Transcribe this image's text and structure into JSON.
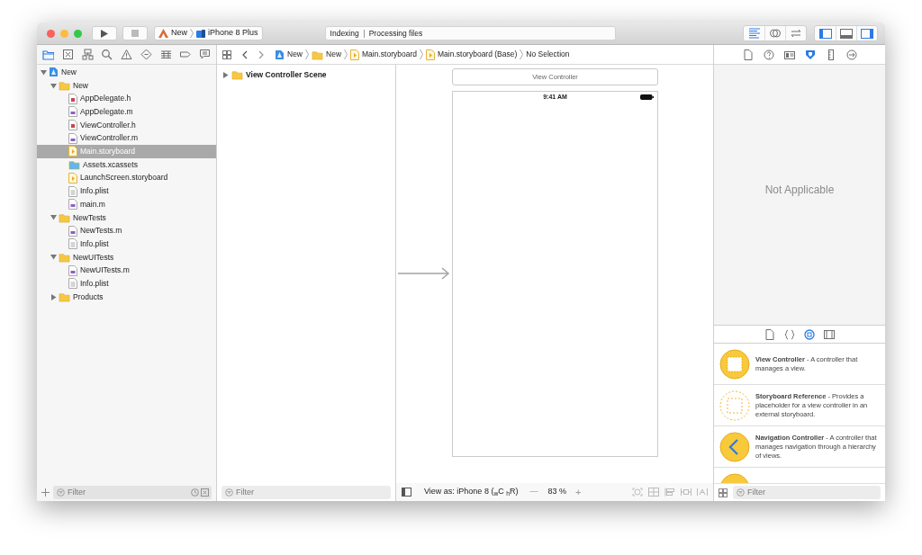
{
  "toolbar": {
    "run_button": {
      "disabled": false
    },
    "stop_button": {
      "disabled": true
    },
    "scheme": {
      "project": "New",
      "device": "iPhone 8 Plus"
    },
    "activity": {
      "status": "Indexing",
      "detail": "Processing files"
    },
    "editor_modes": [
      {
        "kind": "standard",
        "selected": true
      },
      {
        "kind": "assistant",
        "selected": false
      },
      {
        "kind": "version",
        "selected": false
      }
    ],
    "panel_toggles": [
      {
        "kind": "left",
        "on": true
      },
      {
        "kind": "bottom",
        "on": false
      },
      {
        "kind": "right",
        "on": true
      }
    ]
  },
  "navigator": {
    "tabs": [
      {
        "kind": "folder",
        "selected": true
      },
      {
        "kind": "source-control",
        "selected": false
      },
      {
        "kind": "hierarchy",
        "selected": false
      },
      {
        "kind": "search",
        "selected": false
      },
      {
        "kind": "warning",
        "selected": false
      },
      {
        "kind": "test",
        "selected": false
      },
      {
        "kind": "debug",
        "selected": false
      },
      {
        "kind": "breakpoint",
        "selected": false
      },
      {
        "kind": "report",
        "selected": false
      }
    ],
    "tree": [
      {
        "name": "New",
        "kind": "project",
        "expanded": true,
        "selected": false,
        "children": [
          {
            "name": "New",
            "kind": "folder",
            "expanded": true,
            "selected": false,
            "children": [
              {
                "name": "AppDelegate.h",
                "kind": "h",
                "selected": false
              },
              {
                "name": "AppDelegate.m",
                "kind": "m",
                "selected": false
              },
              {
                "name": "ViewController.h",
                "kind": "h",
                "selected": false
              },
              {
                "name": "ViewController.m",
                "kind": "m",
                "selected": false
              },
              {
                "name": "Main.storyboard",
                "kind": "storyboard",
                "selected": true
              },
              {
                "name": "Assets.xcassets",
                "kind": "assets",
                "selected": false
              },
              {
                "name": "LaunchScreen.storyboard",
                "kind": "storyboard",
                "selected": false
              },
              {
                "name": "Info.plist",
                "kind": "plist",
                "selected": false
              },
              {
                "name": "main.m",
                "kind": "m",
                "selected": false
              }
            ]
          },
          {
            "name": "NewTests",
            "kind": "folder",
            "expanded": true,
            "selected": false,
            "children": [
              {
                "name": "NewTests.m",
                "kind": "m",
                "selected": false
              },
              {
                "name": "Info.plist",
                "kind": "plist",
                "selected": false
              }
            ]
          },
          {
            "name": "NewUITests",
            "kind": "folder",
            "expanded": true,
            "selected": false,
            "children": [
              {
                "name": "NewUITests.m",
                "kind": "m",
                "selected": false
              },
              {
                "name": "Info.plist",
                "kind": "plist",
                "selected": false
              }
            ]
          },
          {
            "name": "Products",
            "kind": "folder",
            "expanded": false,
            "selected": false
          }
        ]
      }
    ],
    "filter": {
      "placeholder": "Filter"
    }
  },
  "jump_bar": [
    {
      "label": "New",
      "kind": "project"
    },
    {
      "label": "New",
      "kind": "folder"
    },
    {
      "label": "Main.storyboard",
      "kind": "storyboard"
    },
    {
      "label": "Main.storyboard (Base)",
      "kind": "storyboard"
    },
    {
      "label": "No Selection",
      "kind": "none"
    }
  ],
  "outline": {
    "items": [
      {
        "label": "View Controller Scene",
        "expanded": false
      }
    ],
    "filter": {
      "placeholder": "Filter"
    }
  },
  "canvas": {
    "scene_title": "View Controller",
    "status_time": "9:41 AM",
    "bottom_bar": {
      "view_as": "View as: iPhone 8 ($_{w}$C $_{h}$R)",
      "zoom_out": "—",
      "zoom": "83 %",
      "zoom_in": "+"
    }
  },
  "inspector": {
    "tabs": [
      {
        "kind": "file",
        "selected": false
      },
      {
        "kind": "help",
        "selected": false
      },
      {
        "kind": "identity",
        "selected": false
      },
      {
        "kind": "attributes",
        "selected": true
      },
      {
        "kind": "size",
        "selected": false
      },
      {
        "kind": "connections",
        "selected": false
      }
    ],
    "message": "Not Applicable"
  },
  "library": {
    "tabs": [
      {
        "kind": "file",
        "selected": false
      },
      {
        "kind": "code",
        "selected": false
      },
      {
        "kind": "object",
        "selected": true
      },
      {
        "kind": "media",
        "selected": false
      }
    ],
    "items": [
      {
        "kind": "view-controller",
        "text": "**View Controller** - A controller that manages a view."
      },
      {
        "kind": "storyboard-reference",
        "text": "**Storyboard Reference** - Provides a placeholder for a view controller in an external storyboard."
      },
      {
        "kind": "navigation-controller",
        "text": "**Navigation Controller** - A controller that manages navigation through a hierarchy of views."
      }
    ],
    "filter": {
      "placeholder": "Filter"
    }
  }
}
